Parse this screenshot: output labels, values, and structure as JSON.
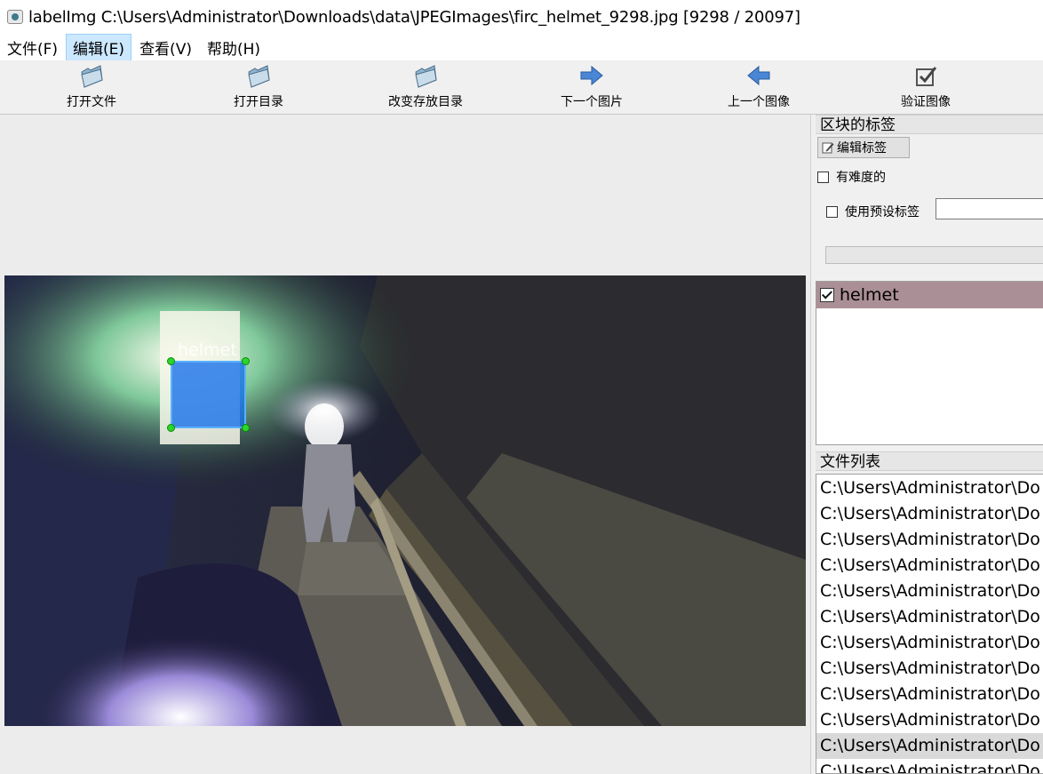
{
  "window": {
    "title": "labelImg C:\\Users\\Administrator\\Downloads\\data\\JPEGImages\\firc_helmet_9298.jpg [9298 / 20097]"
  },
  "menu": [
    "文件(F)",
    "编辑(E)",
    "查看(V)",
    "帮助(H)"
  ],
  "toolbar": {
    "open_file": "打开文件",
    "open_dir": "打开目录",
    "change_save_dir": "改变存放目录",
    "next_image": "下一个图片",
    "prev_image": "上一个图像",
    "verify_image": "验证图像"
  },
  "canvas": {
    "box_label": "helmet"
  },
  "label_panel": {
    "title": "区块的标签",
    "edit_label": "编辑标签",
    "difficult": "有难度的",
    "use_default_label": "使用预设标签",
    "default_label_value": "",
    "labels": [
      {
        "name": "helmet",
        "checked": true
      }
    ]
  },
  "file_panel": {
    "title": "文件列表",
    "items": [
      "C:\\Users\\Administrator\\Do",
      "C:\\Users\\Administrator\\Do",
      "C:\\Users\\Administrator\\Do",
      "C:\\Users\\Administrator\\Do",
      "C:\\Users\\Administrator\\Do",
      "C:\\Users\\Administrator\\Do",
      "C:\\Users\\Administrator\\Do",
      "C:\\Users\\Administrator\\Do",
      "C:\\Users\\Administrator\\Do",
      "C:\\Users\\Administrator\\Do",
      "C:\\Users\\Administrator\\Do",
      "C:\\Users\\Administrator\\Do"
    ],
    "selected_index": 10
  },
  "colors": {
    "label_highlight": "#ab8f96",
    "box_fill": "#146eeb",
    "handle": "#2bd52b"
  }
}
